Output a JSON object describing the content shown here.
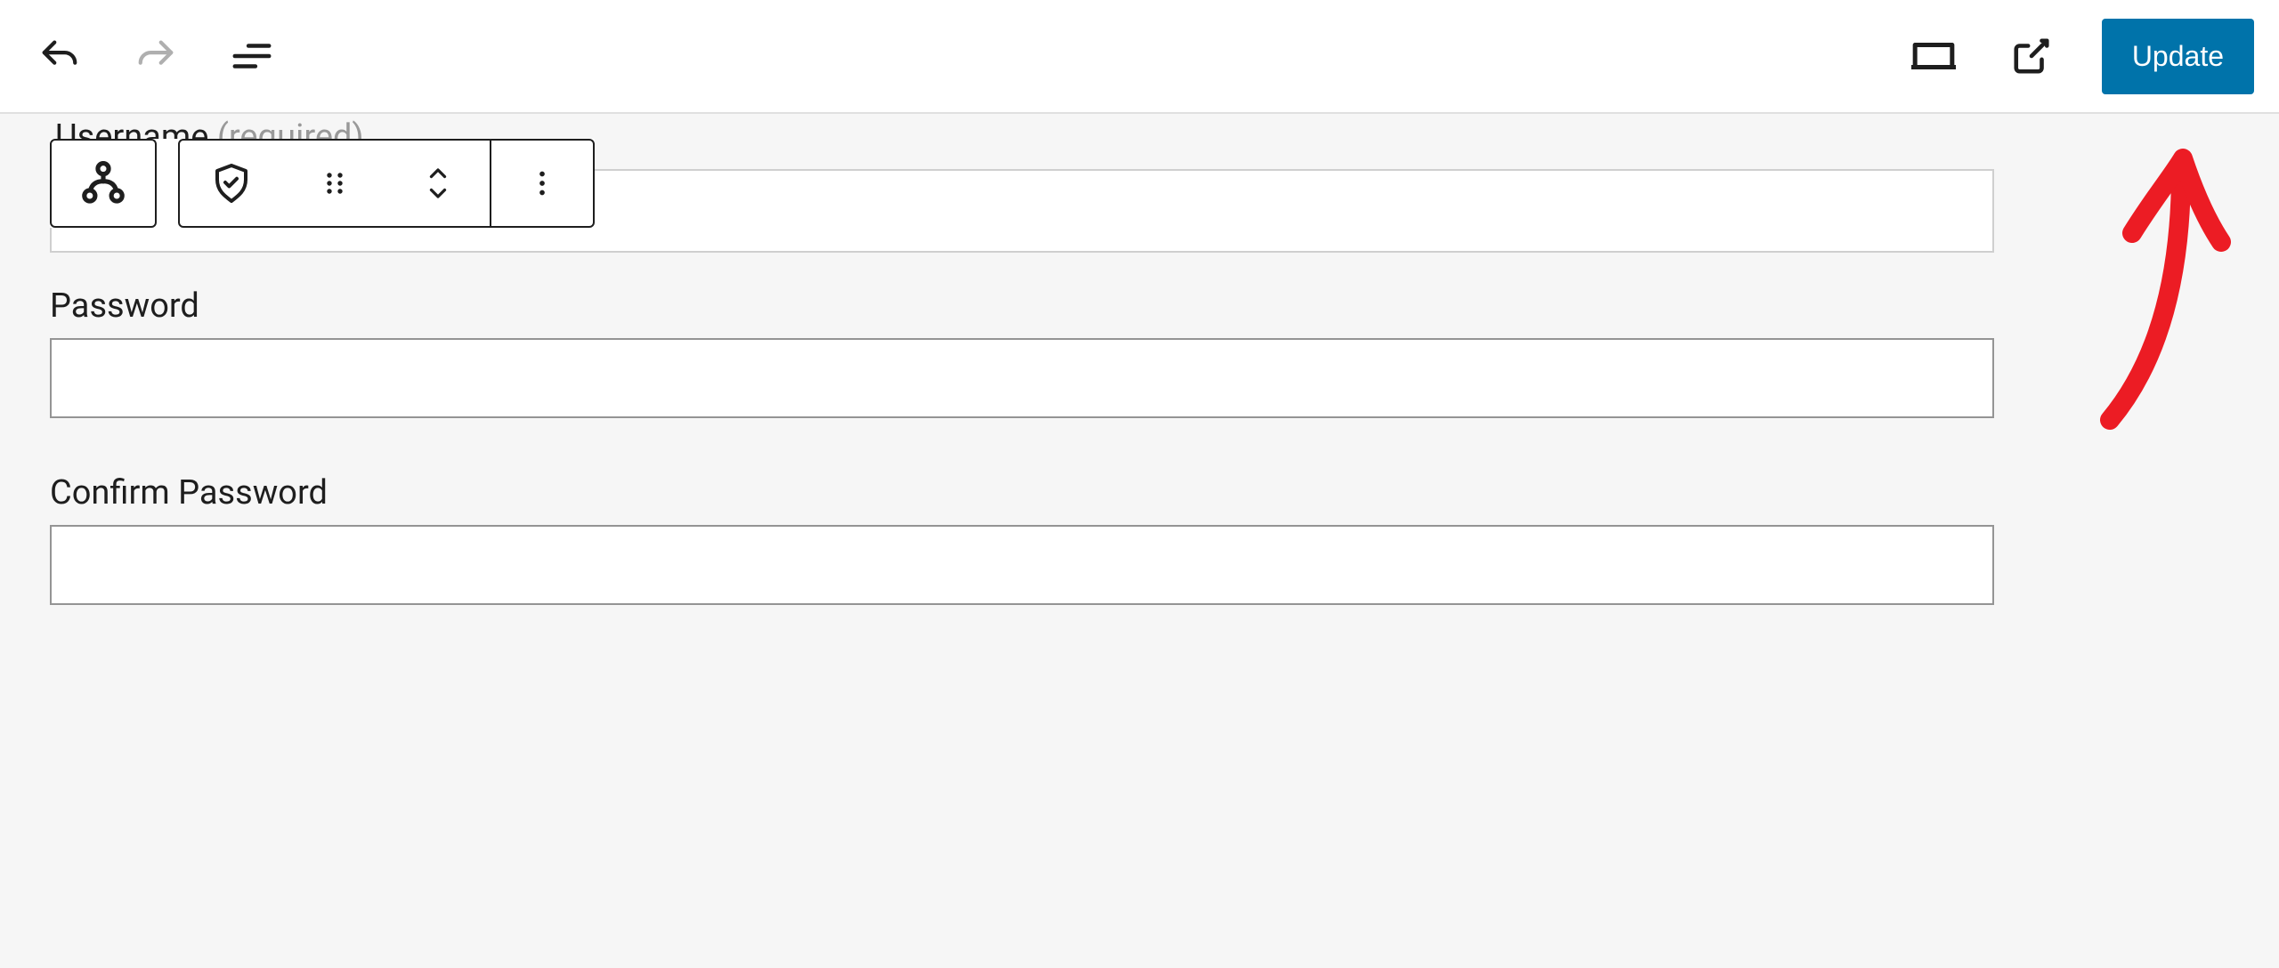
{
  "toolbar": {
    "update_label": "Update"
  },
  "form": {
    "username": {
      "label": "Username",
      "required_suffix": "(required)",
      "value": ""
    },
    "password": {
      "label": "Password",
      "value": ""
    },
    "confirm_password": {
      "label": "Confirm Password",
      "value": ""
    }
  },
  "colors": {
    "accent": "#0073aa",
    "annotation": "#ec1c24"
  }
}
